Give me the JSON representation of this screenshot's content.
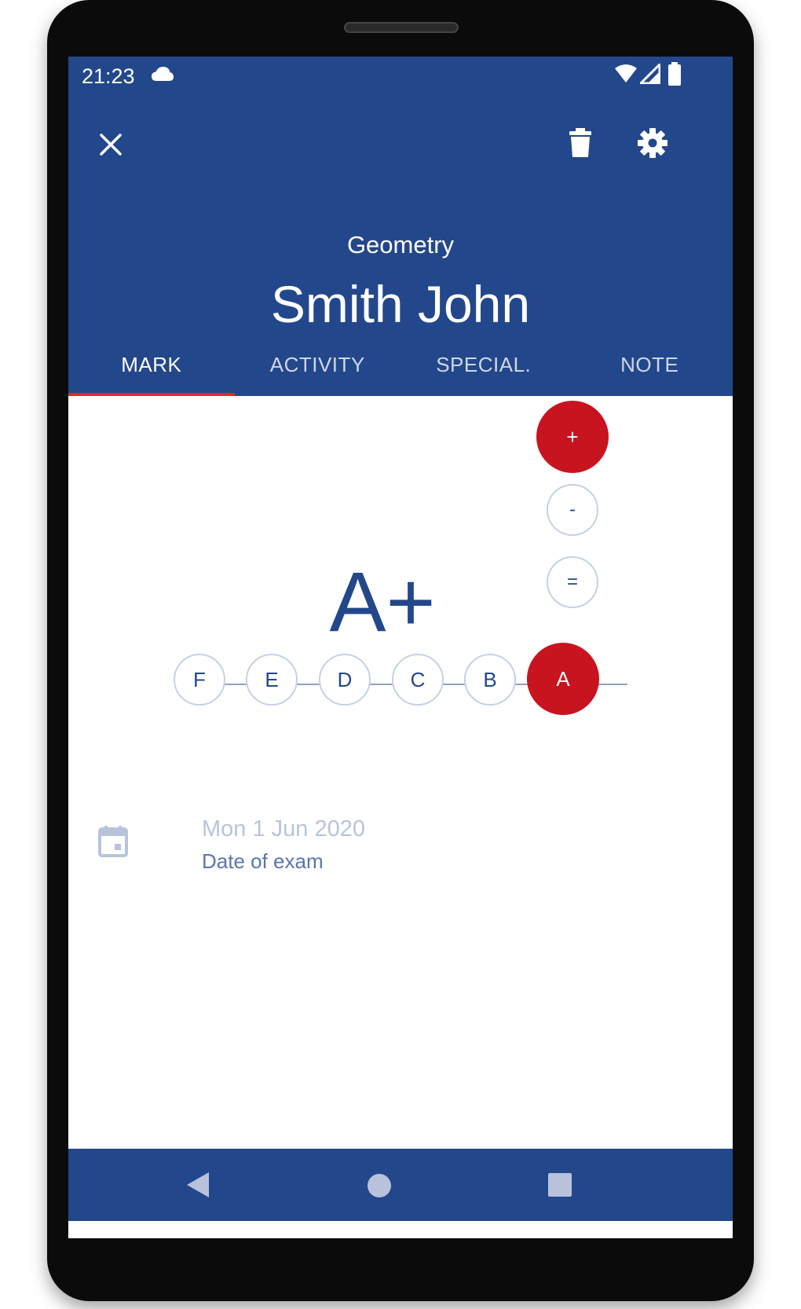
{
  "status": {
    "time": "21:23",
    "icons": [
      "cloud-icon",
      "wifi-icon",
      "signal-icon",
      "battery-icon"
    ]
  },
  "toolbar": {
    "close_icon": "close-icon",
    "delete_icon": "trash-icon",
    "settings_icon": "gear-icon"
  },
  "header": {
    "subject": "Geometry",
    "student": "Smith John"
  },
  "tabs": [
    {
      "label": "MARK",
      "active": true
    },
    {
      "label": "ACTIVITY",
      "active": false
    },
    {
      "label": "SPECIAL.",
      "active": false
    },
    {
      "label": "NOTE",
      "active": false
    }
  ],
  "mark": {
    "current": "A+",
    "modifiers": [
      {
        "label": "+",
        "selected": true
      },
      {
        "label": "-",
        "selected": false
      },
      {
        "label": "=",
        "selected": false
      }
    ],
    "letters": [
      {
        "label": "F",
        "selected": false
      },
      {
        "label": "E",
        "selected": false
      },
      {
        "label": "D",
        "selected": false
      },
      {
        "label": "C",
        "selected": false
      },
      {
        "label": "B",
        "selected": false
      },
      {
        "label": "A",
        "selected": true
      }
    ]
  },
  "date": {
    "value": "Mon 1 Jun 2020",
    "label": "Date of exam",
    "icon": "calendar-icon"
  },
  "navbar": {
    "icons": [
      "back-icon",
      "home-icon",
      "recents-icon"
    ]
  },
  "colors": {
    "primary": "#23478b",
    "accent": "#c8141e",
    "tab_indicator": "#e0262b"
  }
}
